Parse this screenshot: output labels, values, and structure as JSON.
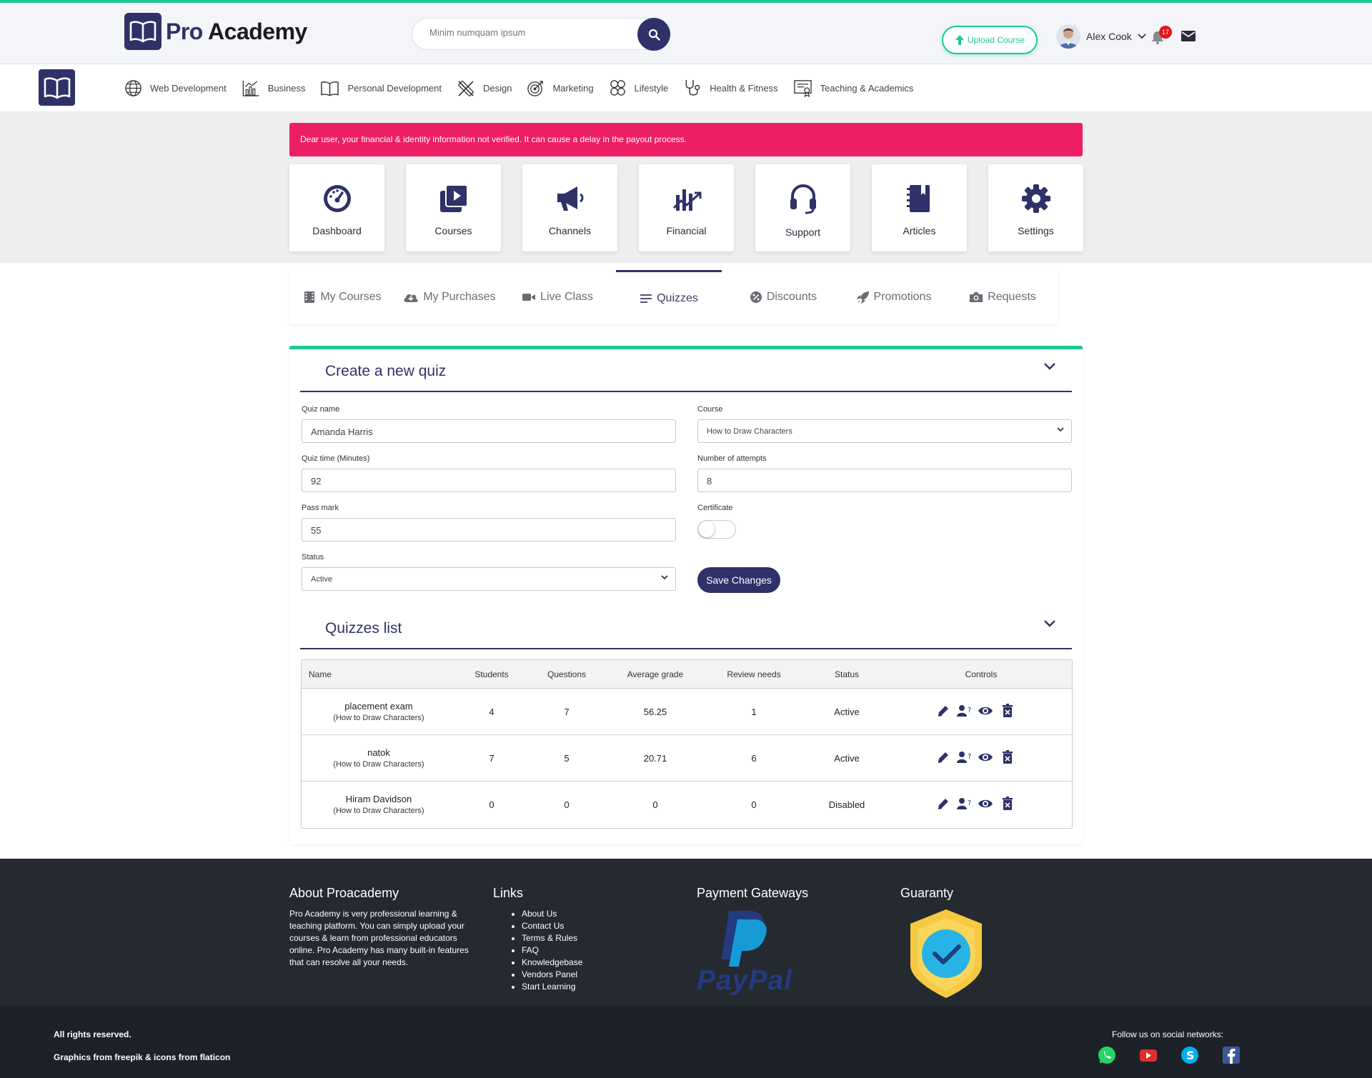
{
  "brand": {
    "pre": "Pro",
    "post": " Academy"
  },
  "search": {
    "placeholder": "Minim numquam ipsum"
  },
  "header": {
    "upload_label": "Upload Course",
    "user_name": "Alex Cook",
    "notifications": "17"
  },
  "categories": [
    {
      "label": "Web Development",
      "icon": "globe-icon"
    },
    {
      "label": "Business",
      "icon": "chart-icon"
    },
    {
      "label": "Personal Development",
      "icon": "book-icon"
    },
    {
      "label": "Design",
      "icon": "design-tools-icon"
    },
    {
      "label": "Marketing",
      "icon": "target-icon"
    },
    {
      "label": "Lifestyle",
      "icon": "lifestyle-icon"
    },
    {
      "label": "Health & Fitness",
      "icon": "stethoscope-icon"
    },
    {
      "label": "Teaching & Academics",
      "icon": "certificate-icon"
    }
  ],
  "alert": "Dear user, your financial & identity information not verified. It can cause a delay in the payout process.",
  "tiles": [
    {
      "label": "Dashboard",
      "icon": "dashboard-icon"
    },
    {
      "label": "Courses",
      "icon": "courses-icon"
    },
    {
      "label": "Channels",
      "icon": "megaphone-icon"
    },
    {
      "label": "Financial",
      "icon": "financial-icon"
    },
    {
      "label": "Support",
      "icon": "headset-icon"
    },
    {
      "label": "Articles",
      "icon": "articles-icon"
    },
    {
      "label": "Settings",
      "icon": "gear-icon"
    }
  ],
  "tabs": [
    {
      "label": "My Courses",
      "icon": "film-icon"
    },
    {
      "label": "My Purchases",
      "icon": "cloud-download-icon"
    },
    {
      "label": "Live Class",
      "icon": "video-camera-icon"
    },
    {
      "label": "Quizzes",
      "icon": "lines-icon",
      "active": true
    },
    {
      "label": "Discounts",
      "icon": "percent-badge-icon"
    },
    {
      "label": "Promotions",
      "icon": "rocket-icon"
    },
    {
      "label": "Requests",
      "icon": "camera-icon"
    }
  ],
  "form": {
    "title": "Create a new quiz",
    "quiz_name_label": "Quiz name",
    "quiz_name_value": "Amanda Harris",
    "course_label": "Course",
    "course_value": "How to Draw Characters",
    "time_label": "Quiz time (Minutes)",
    "time_value": "92",
    "attempts_label": "Number of attempts",
    "attempts_value": "8",
    "pass_label": "Pass mark",
    "pass_value": "55",
    "certificate_label": "Certificate",
    "certificate_on": false,
    "status_label": "Status",
    "status_value": "Active",
    "save_label": "Save Changes"
  },
  "list": {
    "title": "Quizzes list",
    "columns": [
      "Name",
      "Students",
      "Questions",
      "Average grade",
      "Review needs",
      "Status",
      "Controls"
    ],
    "rows": [
      {
        "name": "placement exam",
        "course": "(How to Draw Characters)",
        "students": "4",
        "questions": "7",
        "avg": "56.25",
        "review": "1",
        "status": "Active"
      },
      {
        "name": "natok",
        "course": "(How to Draw Characters)",
        "students": "7",
        "questions": "5",
        "avg": "20.71",
        "review": "6",
        "status": "Active"
      },
      {
        "name": "Hiram Davidson",
        "course": "(How to Draw Characters)",
        "students": "0",
        "questions": "0",
        "avg": "0",
        "review": "0",
        "status": "Disabled"
      }
    ]
  },
  "footer": {
    "about_title": "About Proacademy",
    "about_text": "Pro Academy is very professional learning & teaching platform. You can simply upload your courses & learn from professional educators online. Pro Academy has many built-in features that can resolve all your needs.",
    "links_title": "Links",
    "links": [
      "About Us",
      "Contact Us",
      "Terms & Rules",
      "FAQ",
      "Knowledgebase",
      "Vendors Panel",
      "Start Learning"
    ],
    "payment_title": "Payment Gateways",
    "paypal_text": "PayPal",
    "guaranty_title": "Guaranty",
    "rights": "All rights reserved.",
    "credits": "Graphics from freepik & icons from flaticon",
    "follow": "Follow us on social networks:",
    "social": [
      "whatsapp-icon",
      "youtube-icon",
      "skype-icon",
      "facebook-icon"
    ]
  },
  "colors": {
    "accent": "#1ec896",
    "navy": "#2f3168",
    "alert": "#ec1f62",
    "footer": "#252a31"
  }
}
